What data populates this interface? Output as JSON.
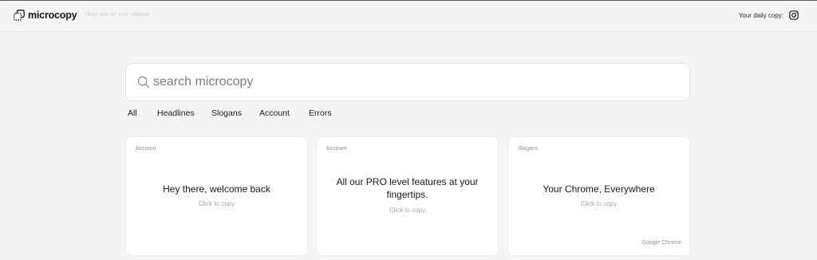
{
  "header": {
    "logo_text": "microcopy",
    "tagline": "Short text for your website.",
    "daily_label": "Your daily copy:",
    "social_icon": "instagram-icon"
  },
  "search": {
    "placeholder": "search microcopy",
    "value": ""
  },
  "tabs": [
    {
      "label": "All"
    },
    {
      "label": "Headlines"
    },
    {
      "label": "Slogans"
    },
    {
      "label": "Account"
    },
    {
      "label": "Errors"
    }
  ],
  "cards": [
    {
      "category": "Account",
      "text": "Hey there, welcome back",
      "action": "Click to copy"
    },
    {
      "category": "Account",
      "text": "All our PRO level features at your fingertips.",
      "action": "Click to copy"
    },
    {
      "category": "Slogans",
      "text": "Your Chrome, Everywhere",
      "action": "Click to copy",
      "source": "Google Chrome"
    }
  ],
  "colors": {
    "background": "#f5f5f4",
    "card": "#ffffff",
    "text": "#1c1c1c",
    "muted": "#a6a6a6"
  }
}
